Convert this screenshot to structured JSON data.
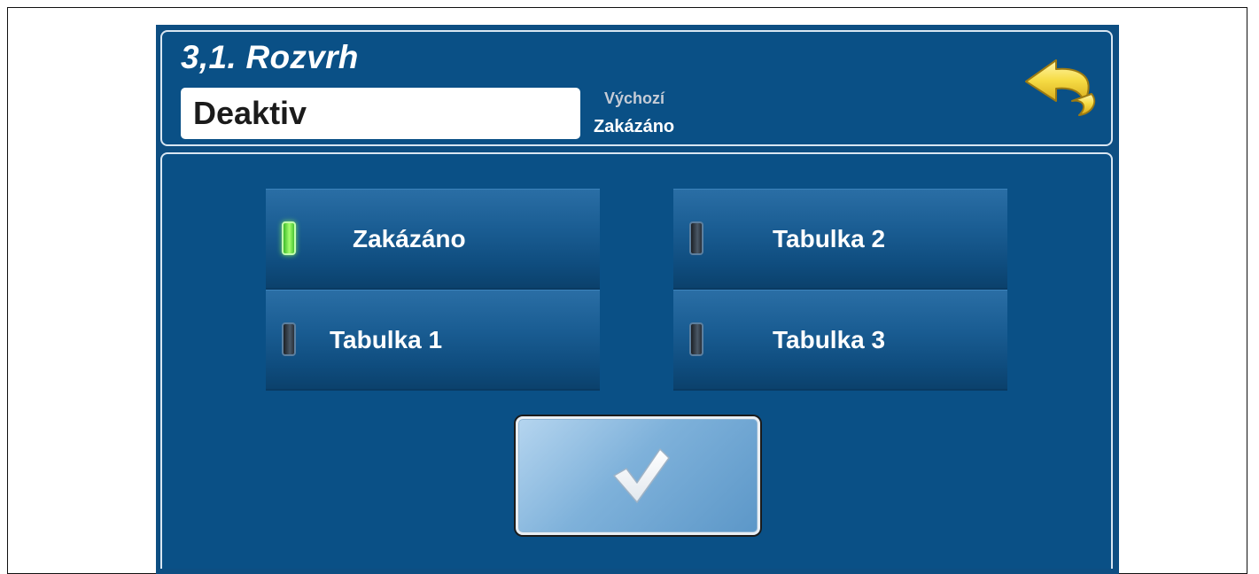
{
  "header": {
    "title": "3,1. Rozvrh",
    "current_value": "Deaktiv",
    "default_label": "Výchozí",
    "default_value": "Zakázáno"
  },
  "options": [
    {
      "label": "Zakázáno",
      "selected": true
    },
    {
      "label": "Tabulka 2",
      "selected": false
    },
    {
      "label": "Tabulka 1",
      "selected": false
    },
    {
      "label": "Tabulka 3",
      "selected": false
    }
  ],
  "icons": {
    "back": "back-arrow-icon",
    "confirm": "checkmark-icon",
    "indicator": "led-indicator-icon"
  },
  "colors": {
    "background": "#0d4e82",
    "led_on": "#7ee85a",
    "back_arrow": "#f2d23a",
    "text": "#ffffff"
  }
}
